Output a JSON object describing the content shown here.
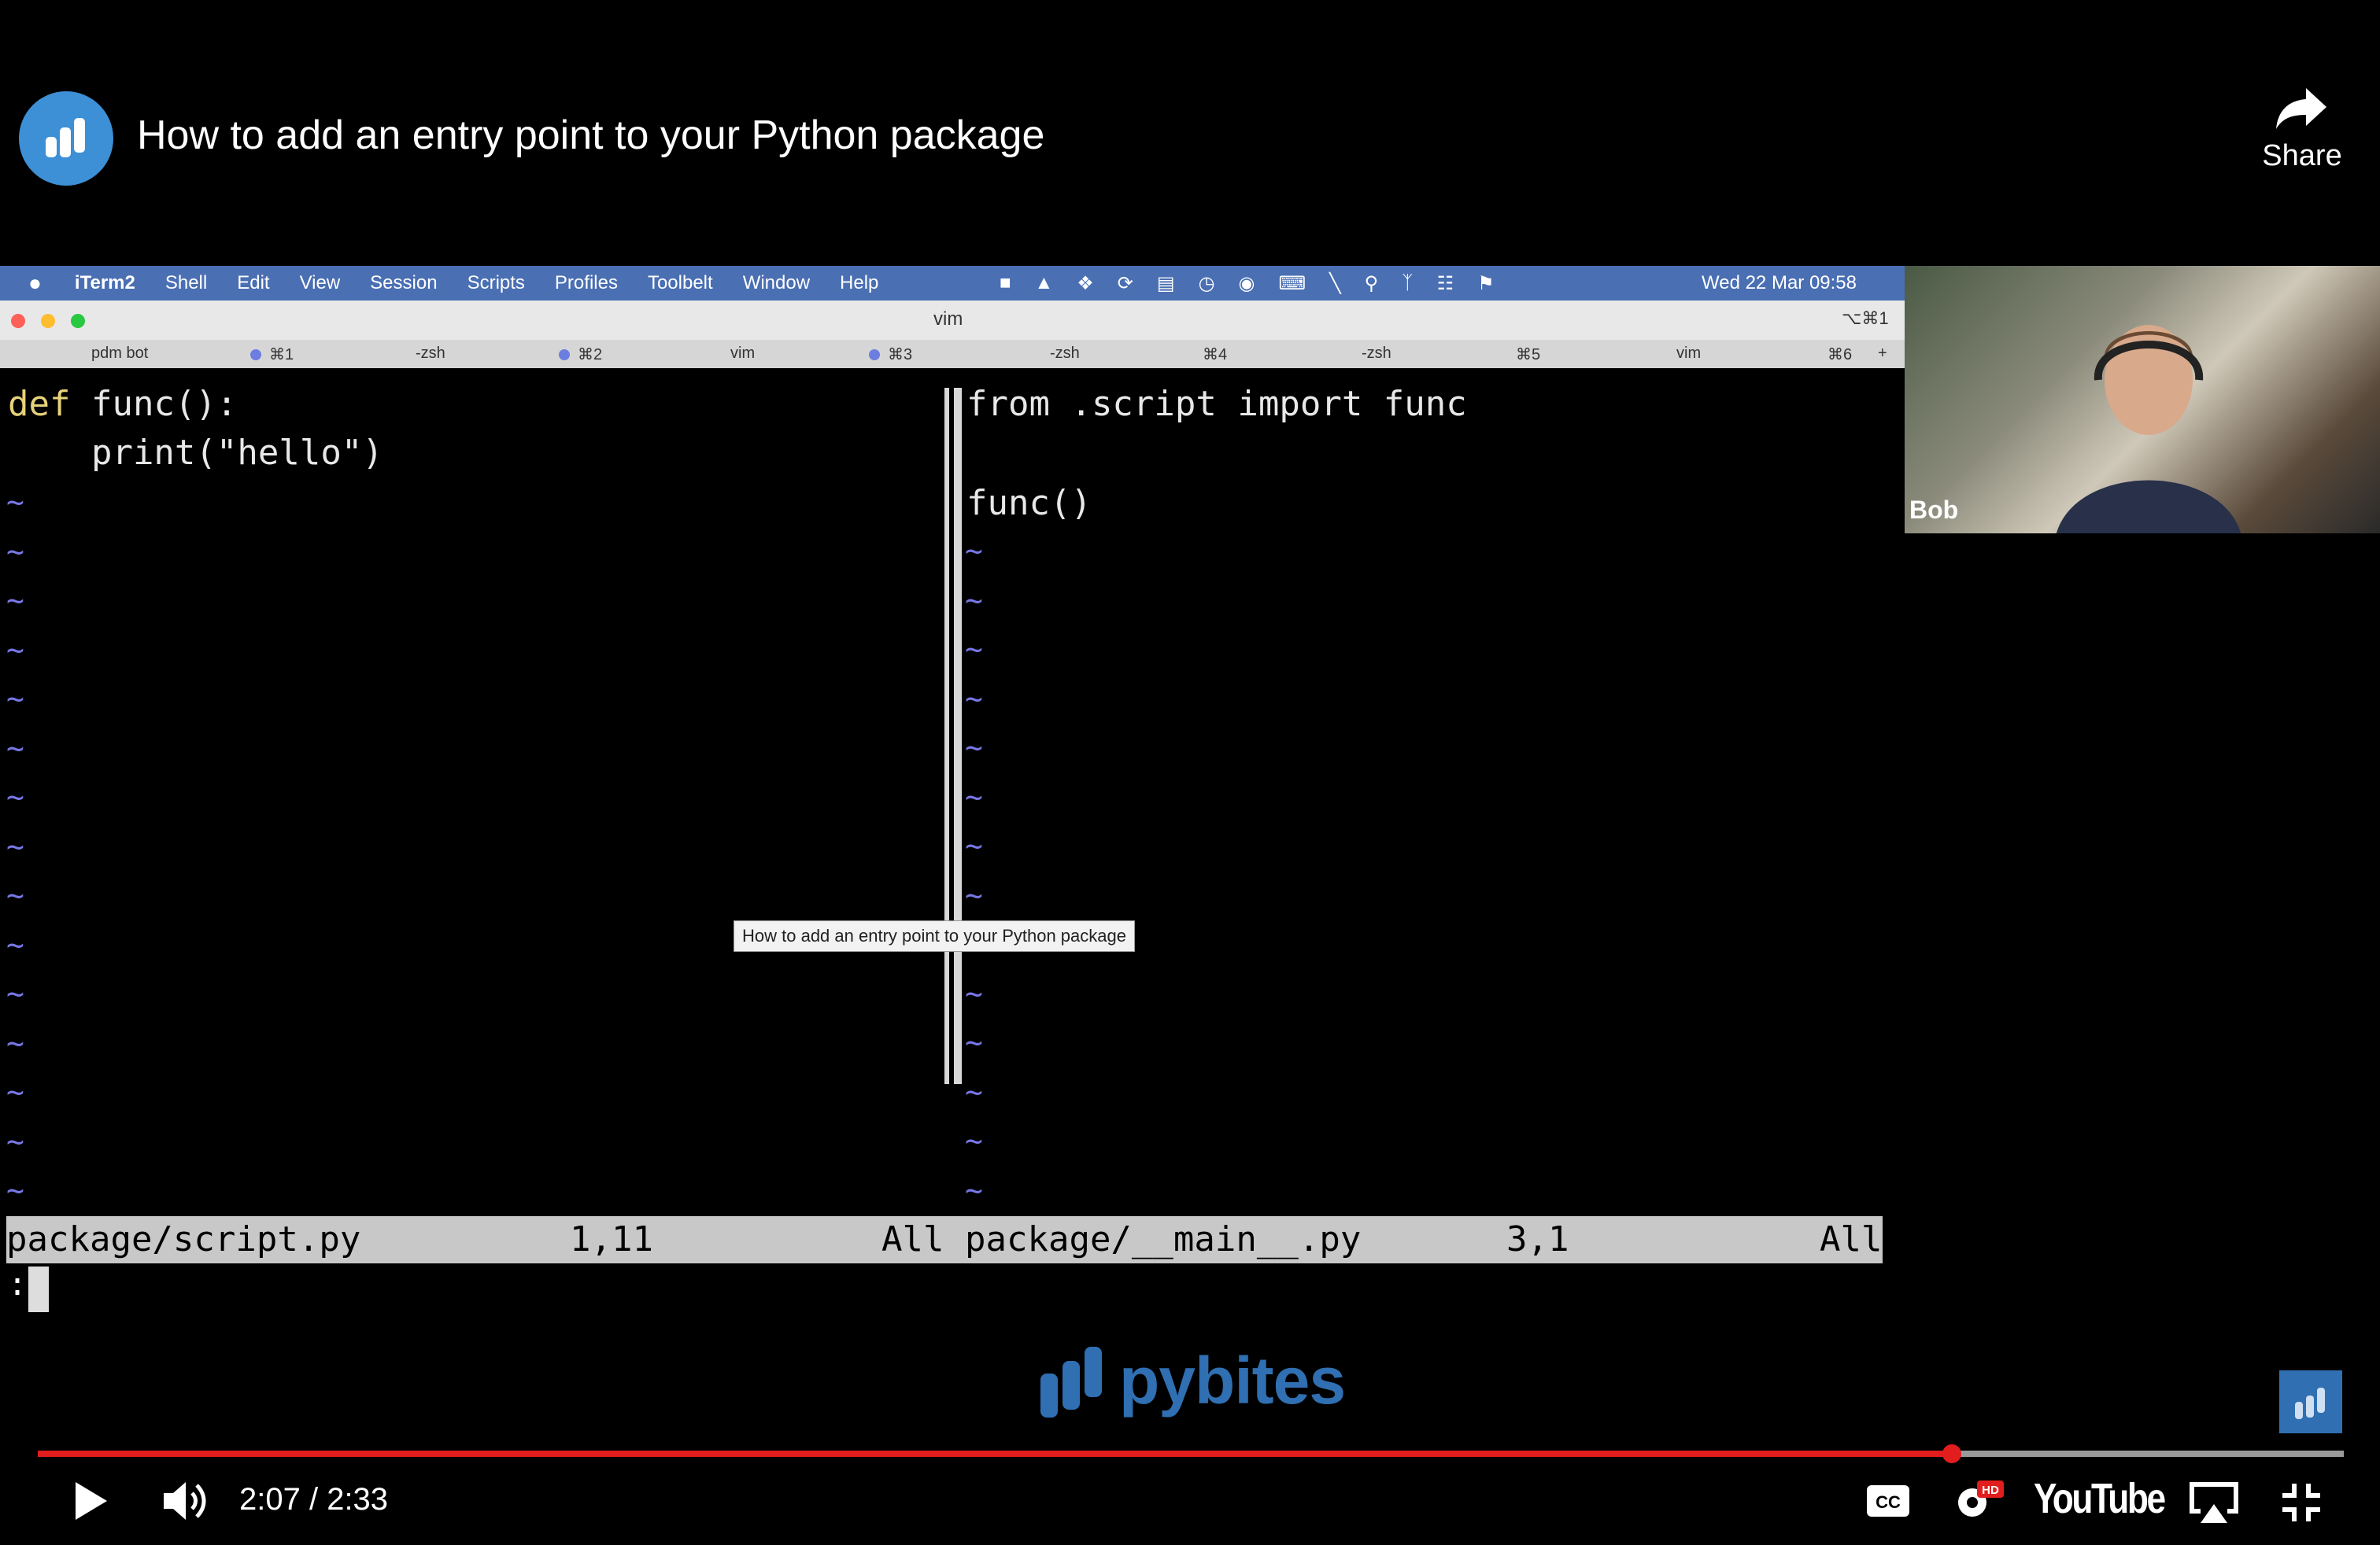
{
  "header": {
    "title": "How to add an entry point to your Python package",
    "share_label": "Share",
    "channel_logo_icon": "pybites-logo-icon"
  },
  "video": {
    "menubar": {
      "app": "iTerm2",
      "items": [
        "Shell",
        "Edit",
        "View",
        "Session",
        "Scripts",
        "Profiles",
        "Toolbelt",
        "Window",
        "Help"
      ],
      "clock": "Wed 22 Mar  09:58"
    },
    "window": {
      "title": "vim",
      "shortcut": "⌥⌘1"
    },
    "tabs": [
      {
        "label": "pdm bot",
        "shortcut": "⌘1",
        "dot": true
      },
      {
        "label": "-zsh",
        "shortcut": "⌘2",
        "dot": true
      },
      {
        "label": "vim",
        "shortcut": "⌘3",
        "dot": true
      },
      {
        "label": "-zsh",
        "shortcut": "⌘4",
        "dot": false
      },
      {
        "label": "-zsh",
        "shortcut": "⌘5",
        "dot": false
      },
      {
        "label": "vim",
        "shortcut": "⌘6",
        "dot": false
      }
    ],
    "left_pane": {
      "line1_keyword": "def",
      "line1_rest": "func():",
      "line2": "    print(\"hello\")",
      "filename": "package/script.py",
      "position": "1,11",
      "scroll": "All"
    },
    "right_pane": {
      "line1": "from .script import func",
      "line3": "func()",
      "filename": "package/__main__.py",
      "position": "3,1",
      "scroll": "All"
    },
    "cmdline": ":",
    "tooltip": "How to add an entry point to your Python package",
    "webcam_name": "Bob",
    "brand": "pybites"
  },
  "player": {
    "current_time": "2:07",
    "duration": "2:33",
    "time_text": "2:07 / 2:33",
    "progress": 0.83,
    "buffered": 1.0,
    "youtube_wordmark": "YouTube",
    "colors": {
      "progress": "#e21d1d",
      "brand": "#2f6fb2"
    }
  }
}
